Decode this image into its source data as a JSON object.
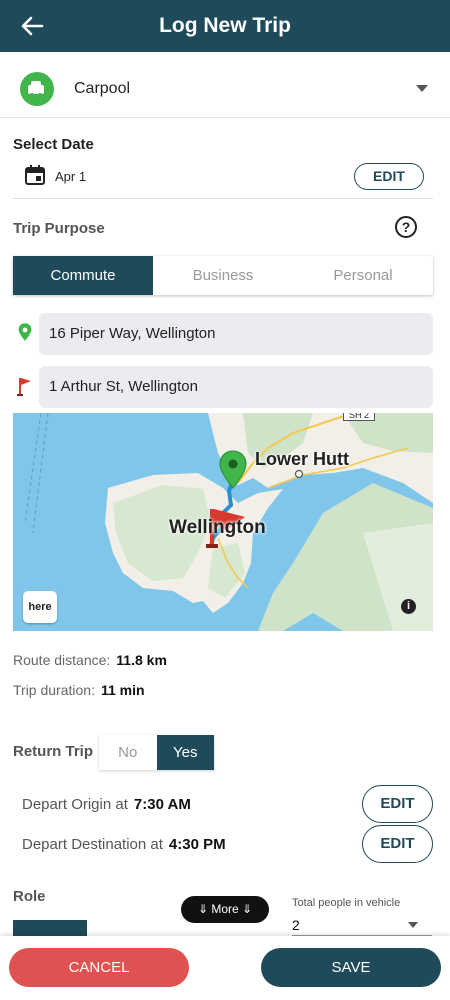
{
  "header": {
    "title": "Log New Trip"
  },
  "mode": {
    "label": "Carpool"
  },
  "date": {
    "section_title": "Select Date",
    "value": "Apr 1",
    "edit_label": "EDIT"
  },
  "purpose": {
    "section_title": "Trip Purpose",
    "help_glyph": "?",
    "options": [
      "Commute",
      "Business",
      "Personal"
    ],
    "selected": "Commute"
  },
  "route": {
    "origin": "16 Piper Way, Wellington",
    "destination": "1 Arthur St, Wellington"
  },
  "map": {
    "city_label": "Wellington",
    "town_label": "Lower Hutt",
    "highway_label": "SH 2",
    "provider_logo_text": "here",
    "info_glyph": "i"
  },
  "stats": {
    "distance_label": "Route distance:",
    "distance_value": "11.8 km",
    "duration_label": "Trip duration:",
    "duration_value": "11 min"
  },
  "return_trip": {
    "label": "Return Trip",
    "no": "No",
    "yes": "Yes",
    "selected": "Yes"
  },
  "depart": {
    "origin_label": "Depart Origin at",
    "origin_time": "7:30 AM",
    "destination_label": "Depart Destination at",
    "destination_time": "4:30 PM",
    "edit_label": "EDIT"
  },
  "role": {
    "label": "Role"
  },
  "more": {
    "label": "⇓ More ⇓"
  },
  "people": {
    "label": "Total people in vehicle",
    "value": "2"
  },
  "actions": {
    "cancel": "CANCEL",
    "save": "SAVE"
  },
  "colors": {
    "primary": "#1e4a5a",
    "cancel": "#e05252",
    "mode_icon": "#3fb54a",
    "origin_pin": "#3fb54a",
    "destination_flag": "#d63a2f"
  }
}
